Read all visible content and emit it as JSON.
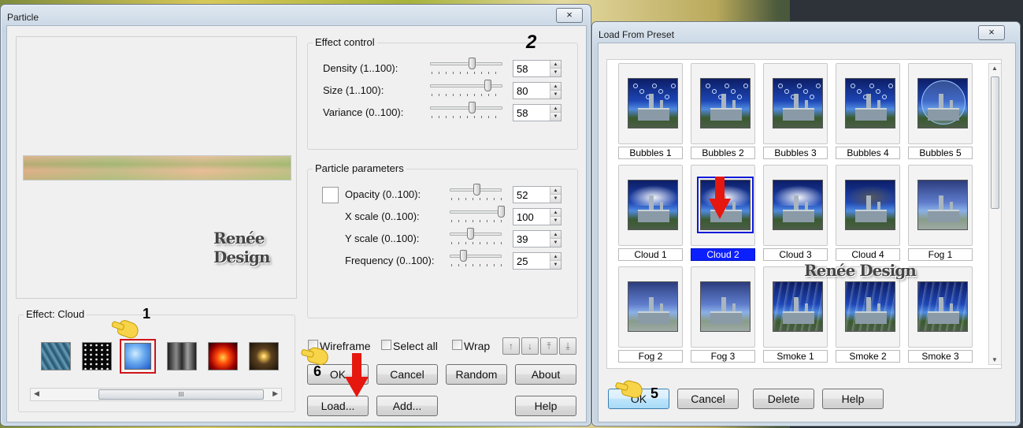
{
  "particle_dialog": {
    "title": "Particle",
    "close": "×",
    "effect_control": {
      "label": "Effect control",
      "rows": [
        {
          "label": "Density (1..100):",
          "value": "58",
          "fraction": 0.58
        },
        {
          "label": "Size (1..100):",
          "value": "80",
          "fraction": 0.8
        },
        {
          "label": "Variance (0..100):",
          "value": "58",
          "fraction": 0.58
        }
      ]
    },
    "particle_params": {
      "label": "Particle parameters",
      "rows": [
        {
          "label": "Opacity (0..100):",
          "value": "52",
          "fraction": 0.52
        },
        {
          "label": "X scale (0..100):",
          "value": "100",
          "fraction": 1.0
        },
        {
          "label": "Y scale (0..100):",
          "value": "39",
          "fraction": 0.39
        },
        {
          "label": "Frequency (0..100):",
          "value": "25",
          "fraction": 0.25
        }
      ]
    },
    "effect_group_label": "Effect: Cloud",
    "effects": [
      "rain",
      "snow",
      "cloud",
      "smoke",
      "fire",
      "sparkle"
    ],
    "selected_effect_index": 2,
    "checkboxes": {
      "wireframe": "Wireframe",
      "select_all": "Select all",
      "wrap": "Wrap"
    },
    "arrow_buttons": [
      "↑",
      "↓",
      "⤒",
      "⤓"
    ],
    "buttons": {
      "ok": "OK",
      "cancel": "Cancel",
      "random": "Random",
      "about": "About",
      "load": "Load...",
      "add": "Add...",
      "help": "Help"
    },
    "scroll_thumb": "III"
  },
  "preset_dialog": {
    "title": "Load From Preset",
    "close": "×",
    "presets": [
      {
        "name": "Bubbles 1",
        "kind": "bubbles"
      },
      {
        "name": "Bubbles 2",
        "kind": "bubbles"
      },
      {
        "name": "Bubbles 3",
        "kind": "bubbles"
      },
      {
        "name": "Bubbles 4",
        "kind": "bubbles"
      },
      {
        "name": "Bubbles 5",
        "kind": "bubble-big"
      },
      {
        "name": "Cloud 1",
        "kind": "cloud"
      },
      {
        "name": "Cloud 2",
        "kind": "cloud",
        "selected": true
      },
      {
        "name": "Cloud 3",
        "kind": "cloud"
      },
      {
        "name": "Cloud 4",
        "kind": "cloud-dark"
      },
      {
        "name": "Fog 1",
        "kind": "fog"
      },
      {
        "name": "Fog 2",
        "kind": "fog"
      },
      {
        "name": "Fog 3",
        "kind": "fog"
      },
      {
        "name": "Smoke 1",
        "kind": "smoke"
      },
      {
        "name": "Smoke 2",
        "kind": "smoke"
      },
      {
        "name": "Smoke 3",
        "kind": "smoke"
      }
    ],
    "buttons": {
      "ok": "OK",
      "cancel": "Cancel",
      "delete": "Delete",
      "help": "Help"
    }
  },
  "annotations": {
    "step1": "1",
    "step2": "2",
    "step5": "5",
    "step6": "6",
    "watermark_left": "Renée Design",
    "watermark_right": "Renée Design",
    "arrow_color": "#e5170f",
    "hand_color": "#f7d44a"
  }
}
